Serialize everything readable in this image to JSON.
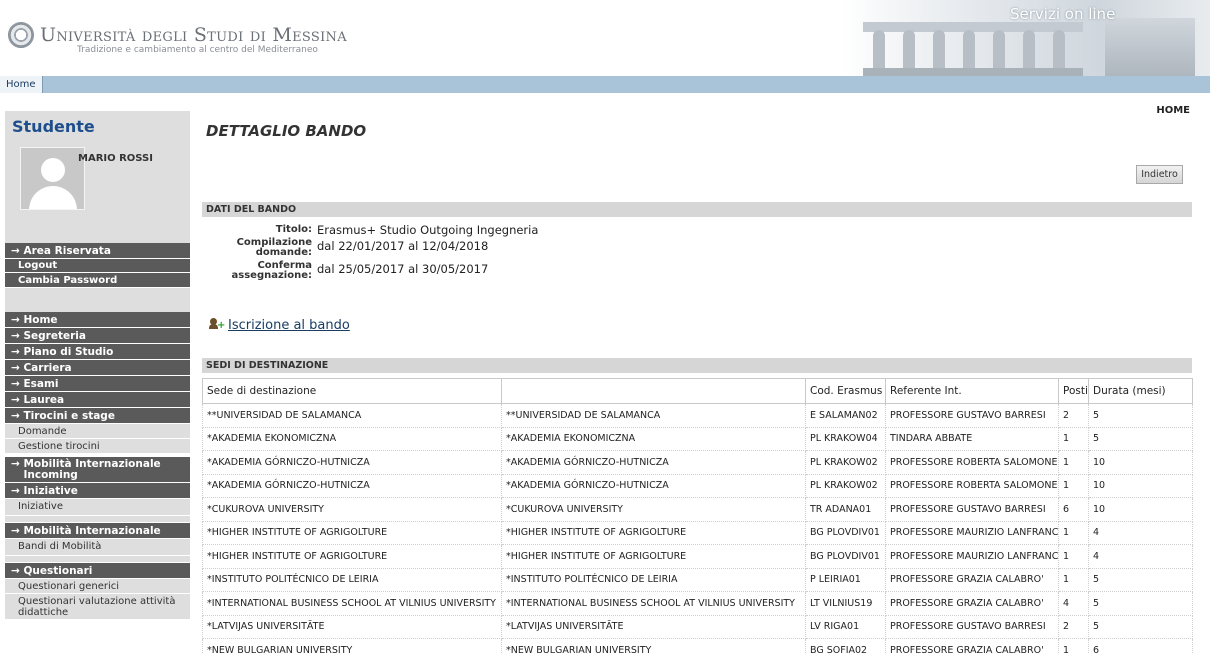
{
  "header": {
    "university_name": "Università degli Studi di Messina",
    "tagline": "Tradizione e cambiamento al centro del Mediterraneo",
    "banner_text": "Servizi on line"
  },
  "navbar": {
    "home_tab": "Home"
  },
  "sidebar": {
    "title": "Studente",
    "student_name": "MARIO ROSSI",
    "area_riservata": {
      "head": "Area Riservata",
      "items": [
        "Logout",
        "Cambia Password"
      ]
    },
    "menu": [
      {
        "label": "Home",
        "subitems": []
      },
      {
        "label": "Segreteria",
        "subitems": []
      },
      {
        "label": "Piano di Studio",
        "subitems": []
      },
      {
        "label": "Carriera",
        "subitems": []
      },
      {
        "label": "Esami",
        "subitems": []
      },
      {
        "label": "Laurea",
        "subitems": []
      },
      {
        "label": "Tirocini e stage",
        "subitems": [
          "Domande",
          "Gestione tirocini"
        ]
      },
      {
        "label": "Mobilità Internazionale Incoming",
        "subitems": []
      },
      {
        "label": "Iniziative",
        "subitems": [
          "Iniziative"
        ]
      },
      {
        "label": "Mobilità Internazionale",
        "subitems": [
          "Bandi di Mobilità"
        ]
      },
      {
        "label": "Questionari",
        "subitems": [
          "Questionari generici",
          "Questionari valutazione attività didattiche"
        ]
      }
    ],
    "arrow_glyph": "→"
  },
  "main": {
    "home_link": "HOME",
    "page_title": "DETTAGLIO BANDO",
    "back_button": "Indietro",
    "dati_section_title": "DATI DEL BANDO",
    "dati": {
      "titolo_label": "Titolo:",
      "titolo_value": "Erasmus+ Studio Outgoing Ingegneria",
      "compilazione_label_1": "Compilazione",
      "compilazione_label_2": "domande:",
      "compilazione_value": "dal 22/01/2017 al 12/04/2018",
      "conferma_label_1": "Conferma",
      "conferma_label_2": "assegnazione:",
      "conferma_value": "dal 25/05/2017 al 30/05/2017"
    },
    "iscrizione_link": "Iscrizione al bando",
    "sedi_section_title": "SEDI DI DESTINAZIONE",
    "table": {
      "headers": [
        "Sede di destinazione",
        "",
        "Cod. Erasmus",
        "Referente Int.",
        "Posti",
        "Durata (mesi)"
      ],
      "rows": [
        [
          "**UNIVERSIDAD DE SALAMANCA",
          "**UNIVERSIDAD DE SALAMANCA",
          "E SALAMAN02",
          "PROFESSORE GUSTAVO BARRESI",
          "2",
          "5"
        ],
        [
          "*AKADEMIA EKONOMICZNA",
          "*AKADEMIA EKONOMICZNA",
          "PL KRAKOW04",
          "TINDARA ABBATE",
          "1",
          "5"
        ],
        [
          "*AKADEMIA GÓRNICZO-HUTNICZA",
          "*AKADEMIA GÓRNICZO-HUTNICZA",
          "PL KRAKOW02",
          "PROFESSORE ROBERTA SALOMONE",
          "1",
          "10"
        ],
        [
          "*AKADEMIA GÓRNICZO-HUTNICZA",
          "*AKADEMIA GÓRNICZO-HUTNICZA",
          "PL KRAKOW02",
          "PROFESSORE ROBERTA SALOMONE",
          "1",
          "10"
        ],
        [
          "*CUKUROVA UNIVERSITY",
          "*CUKUROVA UNIVERSITY",
          "TR ADANA01",
          "PROFESSORE GUSTAVO BARRESI",
          "6",
          "10"
        ],
        [
          "*HIGHER INSTITUTE OF AGRIGOLTURE",
          "*HIGHER INSTITUTE OF AGRIGOLTURE",
          "BG PLOVDIV01",
          "PROFESSORE MAURIZIO LANFRANCHI",
          "1",
          "4"
        ],
        [
          "*HIGHER INSTITUTE OF AGRIGOLTURE",
          "*HIGHER INSTITUTE OF AGRIGOLTURE",
          "BG PLOVDIV01",
          "PROFESSORE MAURIZIO LANFRANCHI",
          "1",
          "4"
        ],
        [
          "*INSTITUTO POLITÉCNICO DE LEIRIA",
          "*INSTITUTO POLITÉCNICO DE LEIRIA",
          "P LEIRIA01",
          "PROFESSORE GRAZIA CALABRO'",
          "1",
          "5"
        ],
        [
          "*INTERNATIONAL BUSINESS SCHOOL AT VILNIUS UNIVERSITY",
          "*INTERNATIONAL BUSINESS SCHOOL AT VILNIUS UNIVERSITY",
          "LT VILNIUS19",
          "PROFESSORE GRAZIA CALABRO'",
          "4",
          "5"
        ],
        [
          "*LATVIJAS UNIVERSITĀTE",
          "*LATVIJAS UNIVERSITĀTE",
          "LV RIGA01",
          "PROFESSORE GUSTAVO BARRESI",
          "2",
          "5"
        ],
        [
          "*NEW BULGARIAN UNIVERSITY",
          "*NEW BULGARIAN UNIVERSITY",
          "BG SOFIA02",
          "PROFESSORE GRAZIA CALABRO'",
          "1",
          "6"
        ]
      ]
    }
  },
  "colors": {
    "navbar": "#a9c4d9",
    "menu_dark": "#5a5a5a",
    "menu_light": "#dedede",
    "title_blue": "#1e4f8c"
  }
}
